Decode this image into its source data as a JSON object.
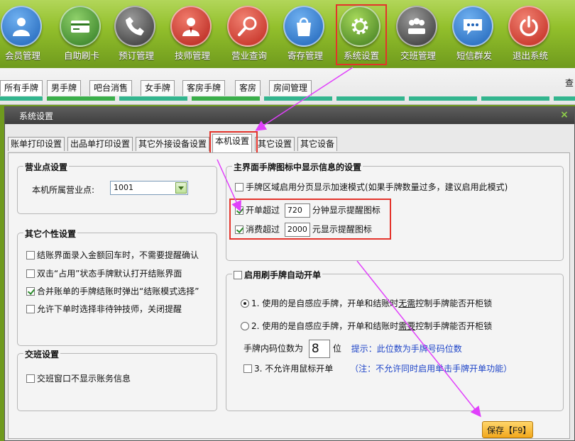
{
  "toolbar": {
    "items": [
      {
        "label": "会员管理",
        "icon": "member-icon",
        "color": "#1e63b8"
      },
      {
        "label": "自助刷卡",
        "icon": "card-icon",
        "color": "#3a8a2a"
      },
      {
        "label": "预订管理",
        "icon": "phone-icon",
        "color": "#4a4a4a"
      },
      {
        "label": "技师管理",
        "icon": "technician-icon",
        "color": "#c0281e"
      },
      {
        "label": "营业查询",
        "icon": "search-icon",
        "color": "#c8281e"
      },
      {
        "label": "寄存管理",
        "icon": "bag-icon",
        "color": "#1e63b8"
      },
      {
        "label": "系统设置",
        "icon": "gear-icon",
        "color": "#3e7a1e"
      },
      {
        "label": "交班管理",
        "icon": "group-icon",
        "color": "#4a4a4a"
      },
      {
        "label": "短信群发",
        "icon": "message-icon",
        "color": "#1e63b8"
      },
      {
        "label": "退出系统",
        "icon": "power-icon",
        "color": "#c8281e"
      }
    ]
  },
  "table_tabs": [
    "所有手牌",
    "男手牌",
    "吧台消售",
    "女手牌",
    "客房手牌",
    "客房",
    "房间管理"
  ],
  "table_peek": "查",
  "dialog": {
    "title": "系统设置",
    "close": "×",
    "tabs": [
      "账单打印设置",
      "出品单打印设置",
      "其它外接设备设置",
      "本机设置",
      "其它设置",
      "其它设备"
    ],
    "sales_point": {
      "title": "营业点设置",
      "label": "本机所属营业点:",
      "value": "1001"
    },
    "personal": {
      "title": "其它个性设置",
      "items": [
        {
          "label": "结账界面录入金额回车时，不需要提醒确认",
          "checked": false
        },
        {
          "label": "双击“占用”状态手牌默认打开结账界面",
          "checked": false
        },
        {
          "label": "合并账单的手牌结账时弹出“结账模式选择”",
          "checked": true
        },
        {
          "label": "允许下单时选择非待钟技师，关闭提醒",
          "checked": false
        }
      ]
    },
    "shift": {
      "title": "交班设置",
      "item": {
        "label": "交班窗口不显示账务信息",
        "checked": false
      }
    },
    "main_display": {
      "title": "主界面手牌图标中显示信息的设置",
      "paging": {
        "label": "手牌区域启用分页显示加速模式(如果手牌数量过多，建议启用此模式)",
        "checked": false
      },
      "open_over": {
        "prefix": "开单超过",
        "value": "720",
        "suffix": "分钟显示提醒图标",
        "checked": true
      },
      "spend_over": {
        "prefix": "消费超过",
        "value": "2000",
        "suffix": "元显示提醒图标",
        "checked": true
      }
    },
    "auto_open": {
      "title": "启用刷手牌自动开单",
      "checked": false,
      "option1": {
        "pre": "1. 使用的是自感应手牌，开单和结账时",
        "em": "无需",
        "post": "控制手牌能否开柜锁",
        "checked": true
      },
      "option2": {
        "pre": "2. 使用的是自感应手牌，开单和结账时",
        "em": "需要",
        "post": "控制手牌能否开柜锁",
        "checked": false
      },
      "digits": {
        "label": "手牌内码位数为",
        "value": "8",
        "unit": "位",
        "hint": "提示：此位数为手牌号码位数"
      },
      "mouse": {
        "label": "3. 不允许用鼠标开单",
        "note": "（注：不允许同时启用单击手牌开单功能）",
        "checked": false
      }
    },
    "save_label": "保存【F9】"
  },
  "colors": {
    "accent_red": "#e4332b",
    "arrow": "#e040fb",
    "toolbar_green": "#93c02c"
  }
}
